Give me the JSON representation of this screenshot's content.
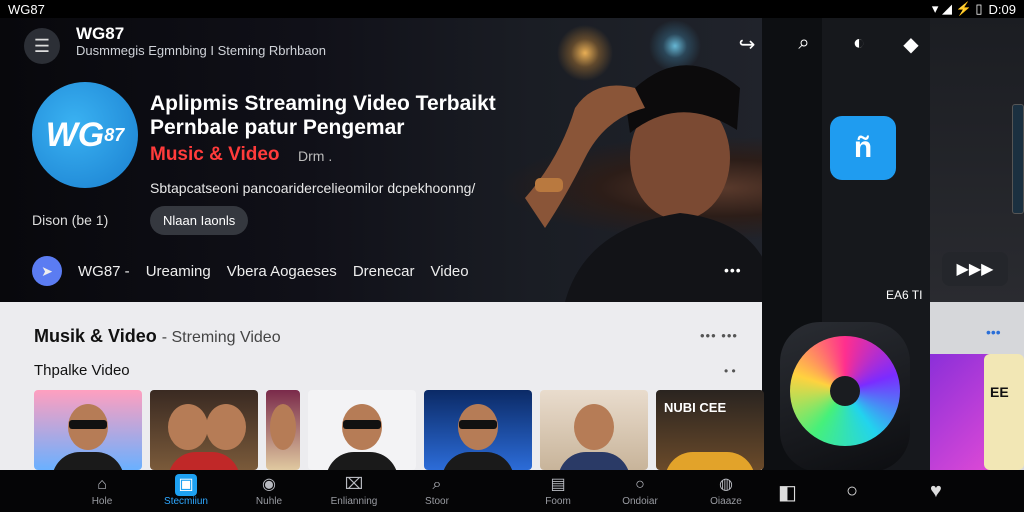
{
  "status_bar": {
    "left_text": "WG87",
    "icons": "▾ ◢ ⚡ ▯",
    "time": "D:09"
  },
  "header": {
    "app_name": "WG87",
    "subtitle": "Dusmmegis Egmnbing  I Steming Rbrhbaon"
  },
  "hero": {
    "logo_text": "WG",
    "logo_sub": "87",
    "title": "Aplipmis Streaming Video Terbaikt Pernbale patur Pengemar",
    "accent": "Music & Video",
    "accent2": "Drm .",
    "description": "Sbtapcatseoni pancoaridercelieomilor dcpekhoonng/",
    "version": "Dison (be 1)",
    "button": "Nlaan Iaonls",
    "nav_items": [
      "WG87 -",
      "Ureaming",
      "Vbera Aogaeses",
      "Drenecar",
      "Video"
    ],
    "more": "•••"
  },
  "right_panel": {
    "icons": [
      "search-icon",
      "volume-icon",
      "cast-icon",
      "library-icon",
      "more-vert-icon"
    ],
    "tile_text": "ñ",
    "label": "EA6 TI",
    "play": "▶▶▶"
  },
  "section": {
    "title": "Musik & Video",
    "title_suffix": "- Streming Video",
    "more": "••• •••",
    "subtitle": "Thpalke Video",
    "sub_more": "• •",
    "thumb_text": "NUBI CEE"
  },
  "strip": {
    "dots": "•••",
    "card_text": "EE"
  },
  "bottom_nav": {
    "tabs": [
      "Hole",
      "Stecmiiun",
      "Nuhle",
      "Enlianning",
      "Stoor",
      "Foom",
      "Ondoiar",
      "Oiaaze"
    ],
    "active_index": 1
  },
  "colors": {
    "accent_blue": "#1da1f2",
    "accent_red": "#ff3b3b"
  }
}
